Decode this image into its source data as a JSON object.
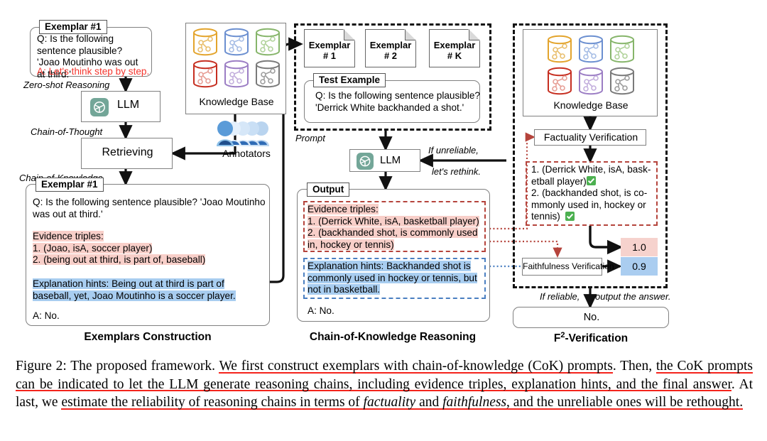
{
  "figure": {
    "left_column": {
      "title": "Exemplars Construction",
      "exemplar_top": {
        "tag": "Exemplar #1",
        "question": "Q: Is the following sentence plausible? 'Joao Moutinho was out at third.'",
        "answer": "A: Let's think step by step."
      },
      "edge_zero_shot": "Zero-shot Reasoning",
      "llm_box": "LLM",
      "edge_cot": "Chain-of-Thought",
      "retrieving_box": "Retrieving",
      "edge_cok": "Chain-of-Knowledge",
      "knowledge_base_label": "Knowledge Base",
      "annotators_label": "Annotators",
      "exemplar_bottom": {
        "tag": "Exemplar #1",
        "question": "Q: Is the following sentence plausible? 'Joao Moutinho was out at third.'",
        "evidence_header": "Evidence triples:",
        "evidence": [
          "1. (Joao, isA, soccer player)",
          "2. (being out at third, is part of, baseball)"
        ],
        "explanation": "Explanation hints: Being out at third is part of baseball, yet, Joao Moutinho is a soccer player.",
        "answer": "A: No."
      }
    },
    "middle_column": {
      "title": "Chain-of-Knowledge Reasoning",
      "exemplar_cards": [
        "Exemplar\n# 1",
        "Exemplar\n# 2",
        "Exemplar\n# K"
      ],
      "exemplar_card_1_line1": "Exemplar",
      "exemplar_card_1_line2": "# 1",
      "exemplar_card_2_line1": "Exemplar",
      "exemplar_card_2_line2": "# 2",
      "exemplar_card_k_line1": "Exemplar",
      "exemplar_card_k_line2": "# K",
      "ellipsis": "...",
      "test_example": {
        "tag": "Test Example",
        "line1": "Q: Is the following sentence plausible?",
        "line2": "'Derrick White backhanded a shot.'"
      },
      "prompt_label": "Prompt",
      "llm_box": "LLM",
      "rethink_line1": "If unreliable,",
      "rethink_line2": "let's rethink.",
      "output": {
        "tag": "Output",
        "evidence_header": "Evidence triples:",
        "evidence_line1": "1. (Derrick White, isA, basketball player)",
        "evidence_line2": "2. (backhanded shot, is commonly used",
        "evidence_line3": "in, hockey or tennis)",
        "explanation_line1": "Explanation hints: Backhanded shot is",
        "explanation_line2": "commonly used in hockey or tennis, but",
        "explanation_line3": "not in basketball.",
        "answer": "A: No."
      }
    },
    "right_column": {
      "title": "F2-Verification",
      "title_base": "F",
      "title_sup": "2",
      "title_rest": "-Verification",
      "knowledge_base_label": "Knowledge Base",
      "factuality_box": "Factuality Verification",
      "verified_triples": {
        "line1": "1. (Derrick White, isA, bask-",
        "line2": "etball player)",
        "line3": "2. (backhanded shot, is co-",
        "line4": "mmonly used in, hockey or",
        "line5": "tennis)",
        "check": "✅"
      },
      "faithfulness_box": "Faithfulness Verification",
      "score_factuality": "1.0",
      "score_faithfulness": "0.9",
      "reliable_line_a": "If reliable,",
      "reliable_line_b": "output the answer.",
      "final_answer": "No."
    },
    "colors": {
      "evidence_highlight": "#f8cfc9",
      "explanation_highlight": "#a8cdf0",
      "red_text": "#f4362e",
      "dashed_red": "#b5443c",
      "dashed_blue": "#4a7fc1",
      "score_pink": "#f6d2cd",
      "score_blue": "#aacdf0",
      "underline_red": "#f4241c"
    },
    "kb_cylinder_colors": [
      "#e3a42c",
      "#6b8fd0",
      "#86b56a",
      "#c62e20",
      "#9b7dc4",
      "#7a7a7a"
    ]
  },
  "caption": {
    "prefix": "Figure 2: The proposed framework. ",
    "s1": "We first construct exemplars with chain-of-knowledge (CoK) prompts",
    "s1_end": ".  Then, ",
    "s2": "the CoK prompts can be indicated to let the LLM generate reasoning chains, including evidence triples, explanation hints, and the final answer",
    "s2_end": ". At last, we ",
    "s3_a": "estimate the reliability of reasoning chains in terms of ",
    "s3_it1": "factuality",
    "s3_b": " and ",
    "s3_it2": "faithfulness",
    "s3_c": ", and the unreliable ones will be rethought."
  }
}
